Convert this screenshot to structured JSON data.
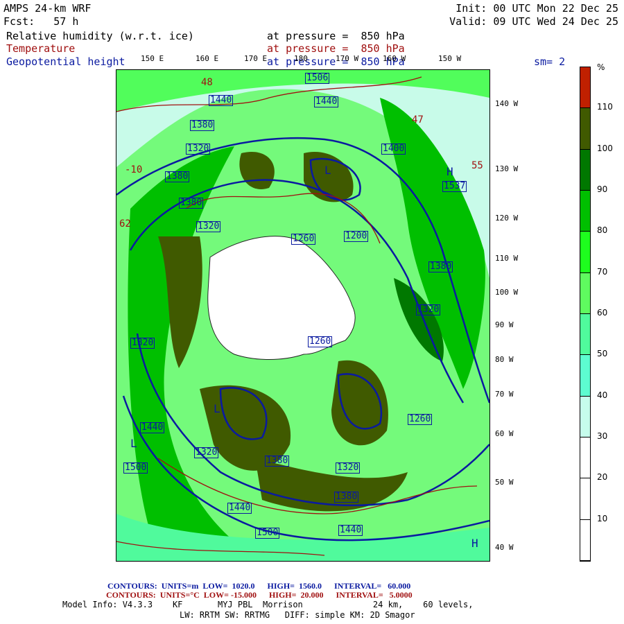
{
  "header": {
    "model": "AMPS 24-km WRF",
    "fcst": "Fcst:   57 h",
    "init": "Init: 00 UTC Mon 22 Dec 25",
    "valid": "Valid: 09 UTC Wed 24 Dec 25",
    "fields": [
      {
        "name": "Relative humidity (w.r.t. ice)",
        "level": "at pressure =  850 hPa",
        "color": "#000000"
      },
      {
        "name": "Temperature",
        "level": "at pressure =  850 hPa",
        "color": "#a01010"
      },
      {
        "name": "Geopotential height",
        "level": "at pressure =  850 hPa",
        "color": "#0a1aa0"
      }
    ],
    "smoothing": "sm= 2"
  },
  "map": {
    "top_lon_labels": [
      "150 E",
      "160 E",
      "170 E",
      "180",
      "170 W",
      "160 W",
      "150 W"
    ],
    "right_labels": [
      "140 W",
      "130 W",
      "120 W",
      "110 W",
      "100 W",
      "90 W",
      "80 W",
      "70 W",
      "60 W",
      "50 W",
      "40 W"
    ],
    "height_labels": [
      "1506",
      "1440",
      "1440",
      "1380",
      "1320",
      "1380",
      "1400",
      "1537",
      "1380",
      "1320",
      "1260",
      "1200",
      "1380",
      "1260",
      "1320",
      "1440",
      "1500",
      "1320",
      "1380",
      "1440",
      "1500",
      "1440",
      "1320",
      "1380",
      "1260",
      "1320"
    ],
    "temp_labels": [
      "48",
      "-10",
      "62",
      "47",
      "55"
    ],
    "hl_labels": [
      "L",
      "L",
      "H",
      "H",
      "L"
    ]
  },
  "colorbar": {
    "unit": "%",
    "levels": [
      "110",
      "100",
      "90",
      "80",
      "70",
      "60",
      "50",
      "40",
      "30",
      "20",
      "10"
    ],
    "colors": [
      "#c02000",
      "#405a00",
      "#007800",
      "#00bf00",
      "#1efe1e",
      "#5ffa5f",
      "#50fa9c",
      "#5dfcd0",
      "#c6fdec",
      "#ffffff",
      "#ffffff",
      "#ffffff"
    ]
  },
  "footer": {
    "height_contours": {
      "label": "CONTOURS:",
      "units": "UNITS=m",
      "low": "LOW=  1020.0",
      "high": "HIGH=  1560.0",
      "interval": "INTERVAL=   60.000"
    },
    "temp_contours": {
      "label": "CONTOURS:",
      "units": "UNITS=°C",
      "low": "LOW= -15.000",
      "high": "HIGH=  20.000",
      "interval": "INTERVAL=   5.0000"
    },
    "model_info": "Model Info: V4.3.3    KF       MYJ PBL  Morrison              24 km,    60 levels,",
    "model_info2": "LW: RRTM SW: RRTMG   DIFF: simple KM: 2D Smagor"
  }
}
